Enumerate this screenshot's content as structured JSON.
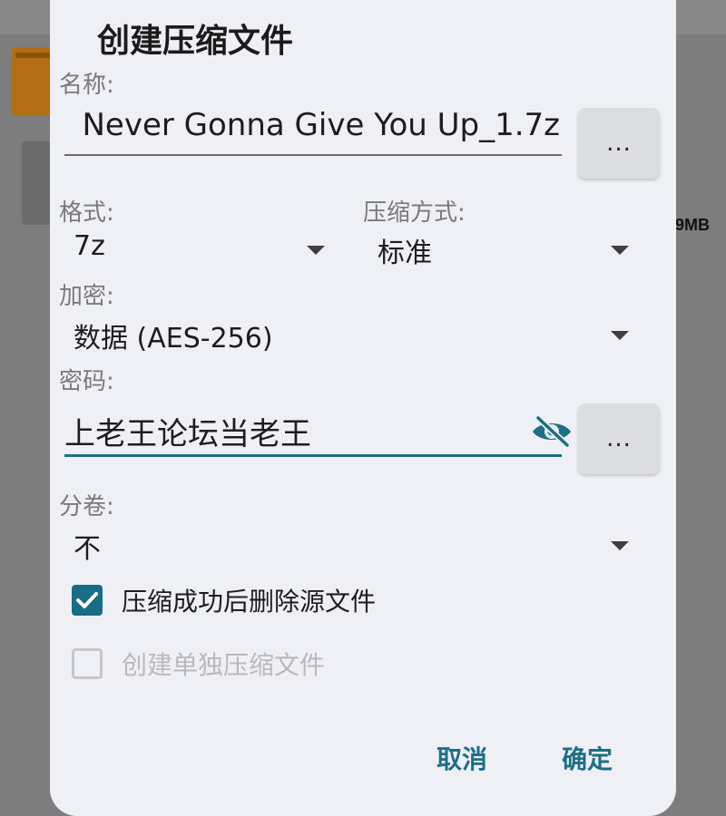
{
  "background": {
    "size_fragment": "9MB"
  },
  "dialog": {
    "title": "创建压缩文件",
    "name": {
      "label": "名称:",
      "value": "Never Gonna Give You Up_1.7z",
      "more_label": "..."
    },
    "format": {
      "label": "格式:",
      "value": "7z"
    },
    "compression": {
      "label": "压缩方式:",
      "value": "标准"
    },
    "encryption": {
      "label": "加密:",
      "value": "数据 (AES-256)"
    },
    "password": {
      "label": "密码:",
      "value": "上老王论坛当老王",
      "more_label": "..."
    },
    "split": {
      "label": "分卷:",
      "value": "不"
    },
    "options": [
      {
        "label": "压缩成功后删除源文件",
        "checked": true,
        "enabled": true
      },
      {
        "label": "创建单独压缩文件",
        "checked": false,
        "enabled": false
      }
    ],
    "buttons": {
      "cancel": "取消",
      "ok": "确定"
    }
  },
  "colors": {
    "accent": "#176d86",
    "dialog_bg": "#eef0f6",
    "scrim": "#7d7d7d"
  },
  "icons": {
    "password_toggle": "eye-off-icon",
    "dropdown": "caret-down-icon",
    "check": "checkmark-icon"
  }
}
